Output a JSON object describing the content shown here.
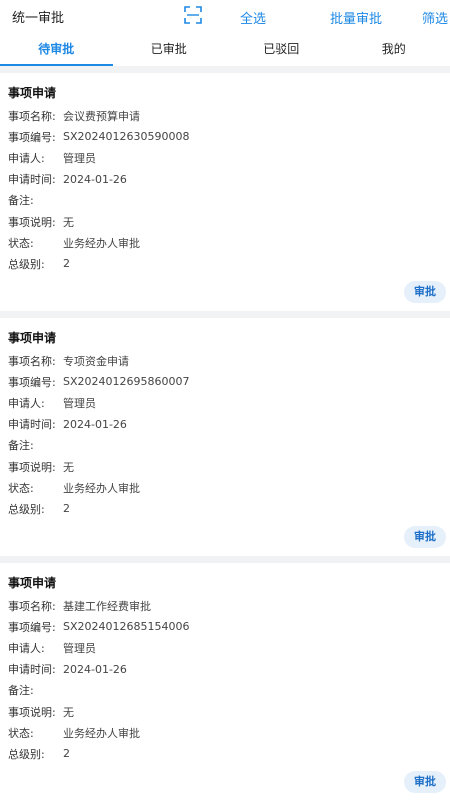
{
  "header": {
    "title": "统一审批",
    "select_all": "全选",
    "batch_approve": "批量审批",
    "filter": "筛选",
    "scan_icon": "scan-icon"
  },
  "tabs": [
    {
      "label": "待审批",
      "active": true
    },
    {
      "label": "已审批",
      "active": false
    },
    {
      "label": "已驳回",
      "active": false
    },
    {
      "label": "我的",
      "active": false
    }
  ],
  "labels": {
    "name": "事项名称:",
    "code": "事项编号:",
    "applicant": "申请人:",
    "time": "申请时间:",
    "remark": "备注:",
    "desc": "事项说明:",
    "status": "状态:",
    "level": "总级别:"
  },
  "items": [
    {
      "title": "事项申请",
      "name": "会议费预算申请",
      "code": "SX2024012630590008",
      "applicant": "管理员",
      "time": "2024-01-26",
      "remark": "",
      "desc": "无",
      "status": "业务经办人审批",
      "level": "2",
      "action": "审批"
    },
    {
      "title": "事项申请",
      "name": "专项资金申请",
      "code": "SX2024012695860007",
      "applicant": "管理员",
      "time": "2024-01-26",
      "remark": "",
      "desc": "无",
      "status": "业务经办人审批",
      "level": "2",
      "action": "审批"
    },
    {
      "title": "事项申请",
      "name": "基建工作经费审批",
      "code": "SX2024012685154006",
      "applicant": "管理员",
      "time": "2024-01-26",
      "remark": "",
      "desc": "无",
      "status": "业务经办人审批",
      "level": "2",
      "action": "审批"
    }
  ],
  "colors": {
    "accent": "#1e88e5",
    "button_bg": "#e6f0fb",
    "divider": "#f1f2f4"
  }
}
